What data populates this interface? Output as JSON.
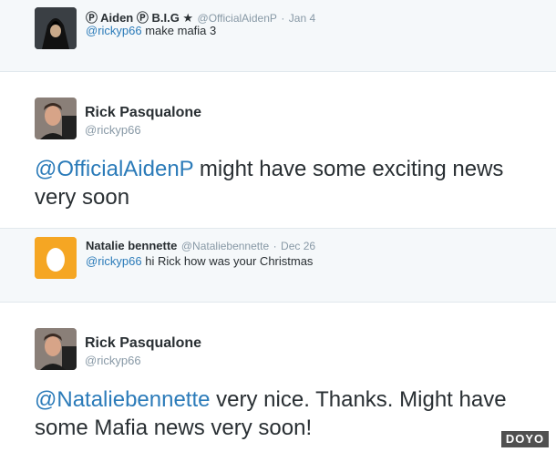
{
  "tweets": [
    {
      "name": "Ⓟ Aiden Ⓟ B.I.G ★",
      "handle": "@OfficialAidenP",
      "dot": "·",
      "date": "Jan 4",
      "mention": "@rickyp66",
      "text": " make mafia 3"
    },
    {
      "name": "Rick Pasqualone",
      "handle": "@rickyp66",
      "mention": "@OfficialAidenP",
      "text": " might have some exciting news very soon"
    },
    {
      "name": "Natalie bennette",
      "handle": "@Nataliebennette",
      "dot": "·",
      "date": "Dec 26",
      "mention": "@rickyp66",
      "text": " hi Rick how was your Christmas"
    },
    {
      "name": "Rick Pasqualone",
      "handle": "@rickyp66",
      "mention": "@Nataliebennette",
      "text": " very nice. Thanks. Might have some Mafia news very soon!"
    }
  ],
  "watermark": "DOYO",
  "colors": {
    "mention": "#2b7bb9",
    "reply_bg": "#f5f8fa",
    "egg_bg": "#f5a623"
  }
}
